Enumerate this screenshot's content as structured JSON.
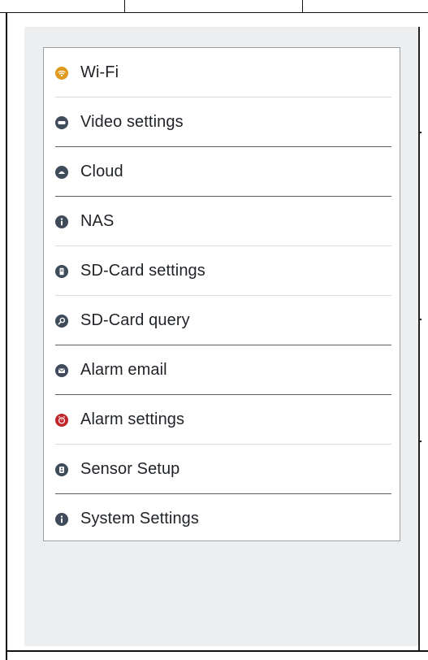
{
  "menu": {
    "items": [
      {
        "label": "Wi-Fi",
        "icon": "wifi-icon",
        "color": "#e09a1e"
      },
      {
        "label": "Video settings",
        "icon": "video-icon",
        "color": "#3f4b5a"
      },
      {
        "label": "Cloud",
        "icon": "cloud-icon",
        "color": "#3f4b5a"
      },
      {
        "label": "NAS",
        "icon": "info-icon",
        "color": "#3f4b5a"
      },
      {
        "label": "SD-Card settings",
        "icon": "sd-card-icon",
        "color": "#3f4b5a"
      },
      {
        "label": "SD-Card query",
        "icon": "search-icon",
        "color": "#3f4b5a"
      },
      {
        "label": "Alarm email",
        "icon": "email-icon",
        "color": "#3f4b5a"
      },
      {
        "label": "Alarm settings",
        "icon": "alarm-icon",
        "color": "#c0272d"
      },
      {
        "label": "Sensor Setup",
        "icon": "sensor-icon",
        "color": "#3f4b5a"
      },
      {
        "label": "System Settings",
        "icon": "info-icon",
        "color": "#3f4b5a"
      }
    ]
  }
}
